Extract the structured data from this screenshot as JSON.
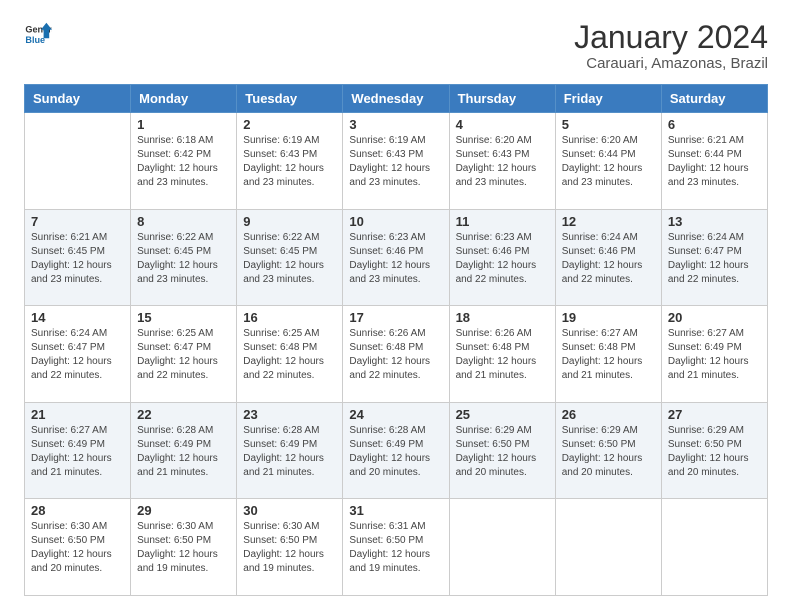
{
  "logo": {
    "line1": "General",
    "line2": "Blue"
  },
  "header": {
    "title": "January 2024",
    "subtitle": "Carauari, Amazonas, Brazil"
  },
  "columns": [
    "Sunday",
    "Monday",
    "Tuesday",
    "Wednesday",
    "Thursday",
    "Friday",
    "Saturday"
  ],
  "weeks": [
    [
      {
        "day": "",
        "info": ""
      },
      {
        "day": "1",
        "info": "Sunrise: 6:18 AM\nSunset: 6:42 PM\nDaylight: 12 hours\nand 23 minutes."
      },
      {
        "day": "2",
        "info": "Sunrise: 6:19 AM\nSunset: 6:43 PM\nDaylight: 12 hours\nand 23 minutes."
      },
      {
        "day": "3",
        "info": "Sunrise: 6:19 AM\nSunset: 6:43 PM\nDaylight: 12 hours\nand 23 minutes."
      },
      {
        "day": "4",
        "info": "Sunrise: 6:20 AM\nSunset: 6:43 PM\nDaylight: 12 hours\nand 23 minutes."
      },
      {
        "day": "5",
        "info": "Sunrise: 6:20 AM\nSunset: 6:44 PM\nDaylight: 12 hours\nand 23 minutes."
      },
      {
        "day": "6",
        "info": "Sunrise: 6:21 AM\nSunset: 6:44 PM\nDaylight: 12 hours\nand 23 minutes."
      }
    ],
    [
      {
        "day": "7",
        "info": "Sunrise: 6:21 AM\nSunset: 6:45 PM\nDaylight: 12 hours\nand 23 minutes."
      },
      {
        "day": "8",
        "info": "Sunrise: 6:22 AM\nSunset: 6:45 PM\nDaylight: 12 hours\nand 23 minutes."
      },
      {
        "day": "9",
        "info": "Sunrise: 6:22 AM\nSunset: 6:45 PM\nDaylight: 12 hours\nand 23 minutes."
      },
      {
        "day": "10",
        "info": "Sunrise: 6:23 AM\nSunset: 6:46 PM\nDaylight: 12 hours\nand 23 minutes."
      },
      {
        "day": "11",
        "info": "Sunrise: 6:23 AM\nSunset: 6:46 PM\nDaylight: 12 hours\nand 22 minutes."
      },
      {
        "day": "12",
        "info": "Sunrise: 6:24 AM\nSunset: 6:46 PM\nDaylight: 12 hours\nand 22 minutes."
      },
      {
        "day": "13",
        "info": "Sunrise: 6:24 AM\nSunset: 6:47 PM\nDaylight: 12 hours\nand 22 minutes."
      }
    ],
    [
      {
        "day": "14",
        "info": "Sunrise: 6:24 AM\nSunset: 6:47 PM\nDaylight: 12 hours\nand 22 minutes."
      },
      {
        "day": "15",
        "info": "Sunrise: 6:25 AM\nSunset: 6:47 PM\nDaylight: 12 hours\nand 22 minutes."
      },
      {
        "day": "16",
        "info": "Sunrise: 6:25 AM\nSunset: 6:48 PM\nDaylight: 12 hours\nand 22 minutes."
      },
      {
        "day": "17",
        "info": "Sunrise: 6:26 AM\nSunset: 6:48 PM\nDaylight: 12 hours\nand 22 minutes."
      },
      {
        "day": "18",
        "info": "Sunrise: 6:26 AM\nSunset: 6:48 PM\nDaylight: 12 hours\nand 21 minutes."
      },
      {
        "day": "19",
        "info": "Sunrise: 6:27 AM\nSunset: 6:48 PM\nDaylight: 12 hours\nand 21 minutes."
      },
      {
        "day": "20",
        "info": "Sunrise: 6:27 AM\nSunset: 6:49 PM\nDaylight: 12 hours\nand 21 minutes."
      }
    ],
    [
      {
        "day": "21",
        "info": "Sunrise: 6:27 AM\nSunset: 6:49 PM\nDaylight: 12 hours\nand 21 minutes."
      },
      {
        "day": "22",
        "info": "Sunrise: 6:28 AM\nSunset: 6:49 PM\nDaylight: 12 hours\nand 21 minutes."
      },
      {
        "day": "23",
        "info": "Sunrise: 6:28 AM\nSunset: 6:49 PM\nDaylight: 12 hours\nand 21 minutes."
      },
      {
        "day": "24",
        "info": "Sunrise: 6:28 AM\nSunset: 6:49 PM\nDaylight: 12 hours\nand 20 minutes."
      },
      {
        "day": "25",
        "info": "Sunrise: 6:29 AM\nSunset: 6:50 PM\nDaylight: 12 hours\nand 20 minutes."
      },
      {
        "day": "26",
        "info": "Sunrise: 6:29 AM\nSunset: 6:50 PM\nDaylight: 12 hours\nand 20 minutes."
      },
      {
        "day": "27",
        "info": "Sunrise: 6:29 AM\nSunset: 6:50 PM\nDaylight: 12 hours\nand 20 minutes."
      }
    ],
    [
      {
        "day": "28",
        "info": "Sunrise: 6:30 AM\nSunset: 6:50 PM\nDaylight: 12 hours\nand 20 minutes."
      },
      {
        "day": "29",
        "info": "Sunrise: 6:30 AM\nSunset: 6:50 PM\nDaylight: 12 hours\nand 19 minutes."
      },
      {
        "day": "30",
        "info": "Sunrise: 6:30 AM\nSunset: 6:50 PM\nDaylight: 12 hours\nand 19 minutes."
      },
      {
        "day": "31",
        "info": "Sunrise: 6:31 AM\nSunset: 6:50 PM\nDaylight: 12 hours\nand 19 minutes."
      },
      {
        "day": "",
        "info": ""
      },
      {
        "day": "",
        "info": ""
      },
      {
        "day": "",
        "info": ""
      }
    ]
  ]
}
